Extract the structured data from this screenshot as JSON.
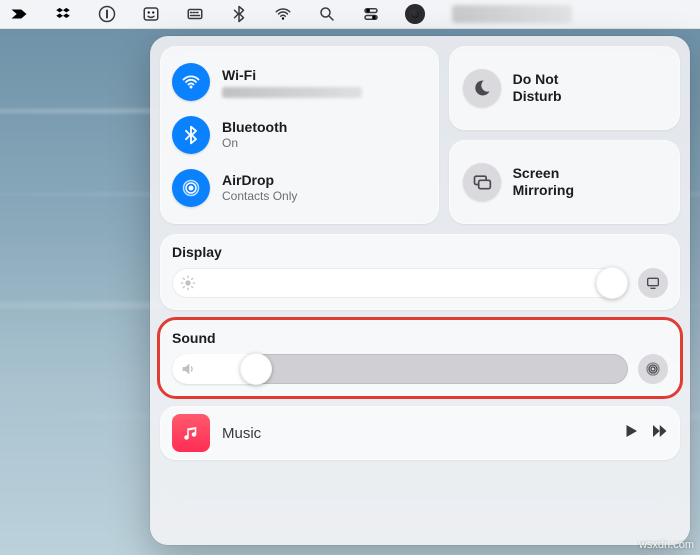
{
  "menubar": {
    "items": [
      {
        "name": "app-shortcut-icon"
      },
      {
        "name": "dropbox-icon"
      },
      {
        "name": "onepassword-icon"
      },
      {
        "name": "finder-extra-icon"
      },
      {
        "name": "keyboard-input-icon"
      },
      {
        "name": "bluetooth-icon"
      },
      {
        "name": "wifi-icon"
      },
      {
        "name": "spotlight-icon"
      },
      {
        "name": "control-center-icon"
      },
      {
        "name": "siri-icon"
      }
    ]
  },
  "control_center": {
    "connectivity": {
      "wifi": {
        "title": "Wi-Fi",
        "subtitle": ""
      },
      "bluetooth": {
        "title": "Bluetooth",
        "subtitle": "On"
      },
      "airdrop": {
        "title": "AirDrop",
        "subtitle": "Contacts Only"
      }
    },
    "dnd": {
      "line1": "Do Not",
      "line2": "Disturb"
    },
    "mirror": {
      "line1": "Screen",
      "line2": "Mirroring"
    },
    "display": {
      "heading": "Display",
      "value_percent": 100
    },
    "sound": {
      "heading": "Sound",
      "value_percent": 16,
      "highlighted": true
    },
    "music": {
      "title": "Music"
    }
  },
  "watermark": "wsxdn.com"
}
